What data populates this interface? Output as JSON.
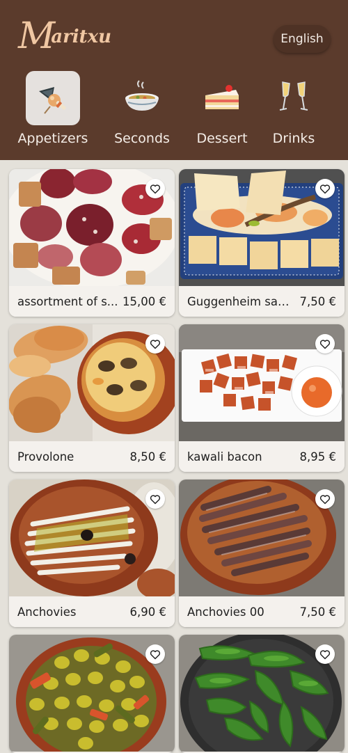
{
  "header": {
    "logo": {
      "initial": "M",
      "rest": "aritxu"
    },
    "language_button": "English"
  },
  "categories": [
    {
      "label": "Appetizers",
      "icon": "tapas-icon",
      "active": true
    },
    {
      "label": "Seconds",
      "icon": "soup-bowl-icon",
      "active": false
    },
    {
      "label": "Dessert",
      "icon": "cake-slice-icon",
      "active": false
    },
    {
      "label": "Drinks",
      "icon": "champagne-glasses-icon",
      "active": false
    }
  ],
  "products": [
    {
      "name": "assortment of s...",
      "price": "15,00 €",
      "photo": "cured-meats-board"
    },
    {
      "name": "Guggenheim salad",
      "price": "7,50 €",
      "photo": "salad-toasts"
    },
    {
      "name": "Provolone",
      "price": "8,50 €",
      "photo": "baked-provolone"
    },
    {
      "name": "kawali bacon",
      "price": "8,95 €",
      "photo": "fried-bacon"
    },
    {
      "name": "Anchovies",
      "price": "6,90 €",
      "photo": "white-anchovies"
    },
    {
      "name": "Anchovies 00",
      "price": "7,50 €",
      "photo": "anchovy-fillets"
    },
    {
      "name": "",
      "price": "",
      "photo": "olives-bowl"
    },
    {
      "name": "",
      "price": "",
      "photo": "padron-peppers"
    }
  ],
  "colors": {
    "header_bg": "#5b3b2c",
    "logo": "#f0c7a3",
    "page_bg": "#e4e1da",
    "card_bg": "#f4f1ed"
  }
}
